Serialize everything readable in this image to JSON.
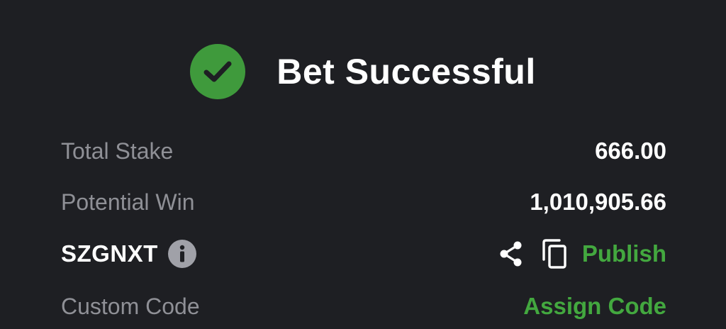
{
  "header": {
    "title": "Bet Successful",
    "icon": "check-circle-icon",
    "icon_color": "#3f9a3c"
  },
  "rows": {
    "total_stake": {
      "label": "Total Stake",
      "value": "666.00"
    },
    "potential_win": {
      "label": "Potential Win",
      "value": "1,010,905.66"
    },
    "booking": {
      "code": "SZGNXT",
      "info_icon": "info-icon",
      "share_icon": "share-icon",
      "copy_icon": "copy-icon",
      "publish_label": "Publish"
    },
    "custom_code": {
      "label": "Custom Code",
      "action_label": "Assign Code"
    }
  },
  "colors": {
    "background": "#1e1f23",
    "accent_green": "#43a83f",
    "label_gray": "#8f9096"
  }
}
